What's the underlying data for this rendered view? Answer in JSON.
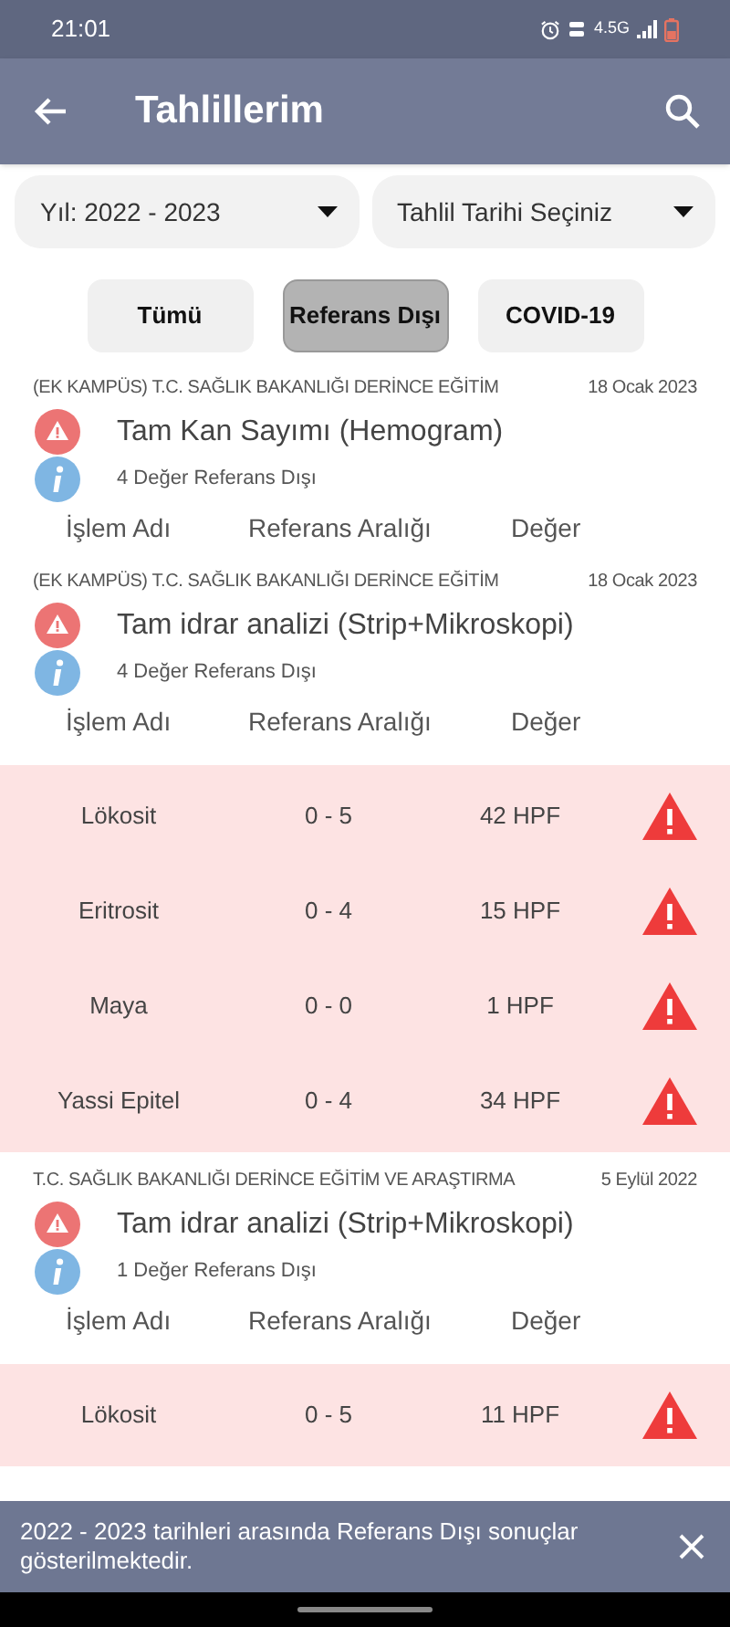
{
  "status_bar": {
    "time": "21:01",
    "network": "4.5G"
  },
  "app_bar": {
    "title": "Tahlillerim"
  },
  "filters": [
    {
      "label": "Yıl: 2022 - 2023"
    },
    {
      "label": "Tahlil Tarihi Seçiniz"
    }
  ],
  "tabs": [
    {
      "label": "Tümü",
      "selected": false
    },
    {
      "label": "Referans Dışı",
      "selected": true
    },
    {
      "label": "COVID-19",
      "selected": false
    }
  ],
  "results": [
    {
      "institution": "(EK KAMPÜS) T.C. SAĞLIK BAKANLIĞI DERİNCE EĞİTİM",
      "date": "18 Ocak 2023",
      "test": "Tam Kan Sayımı (Hemogram)",
      "summary": "4 Değer Referans Dışı",
      "columns": [
        "İşlem Adı",
        "Referans Aralığı",
        "Değer"
      ]
    },
    {
      "institution": "(EK KAMPÜS) T.C. SAĞLIK BAKANLIĞI DERİNCE EĞİTİM",
      "date": "18 Ocak 2023",
      "test": "Tam idrar analizi (Strip+Mikroskopi)",
      "summary": "4 Değer Referans Dışı",
      "columns": [
        "İşlem Adı",
        "Referans Aralığı",
        "Değer"
      ],
      "rows": [
        {
          "name": "Lökosit",
          "range": "0 - 5",
          "value": "42 HPF"
        },
        {
          "name": "Eritrosit",
          "range": "0 - 4",
          "value": "15 HPF"
        },
        {
          "name": "Maya",
          "range": "0 - 0",
          "value": "1 HPF"
        },
        {
          "name": "Yassi Epitel",
          "range": "0 - 4",
          "value": "34 HPF"
        }
      ]
    },
    {
      "institution": "T.C. SAĞLIK BAKANLIĞI DERİNCE EĞİTİM VE ARAŞTIRMA",
      "date": "5 Eylül 2022",
      "test": "Tam idrar analizi (Strip+Mikroskopi)",
      "summary": "1 Değer Referans Dışı",
      "columns": [
        "İşlem Adı",
        "Referans Aralığı",
        "Değer"
      ],
      "rows": [
        {
          "name": "Lökosit",
          "range": "0 - 5",
          "value": "11 HPF"
        }
      ]
    }
  ],
  "snackbar": {
    "message": "2022 - 2023 tarihleri arasında Referans Dışı sonuçlar gösterilmektedir."
  }
}
